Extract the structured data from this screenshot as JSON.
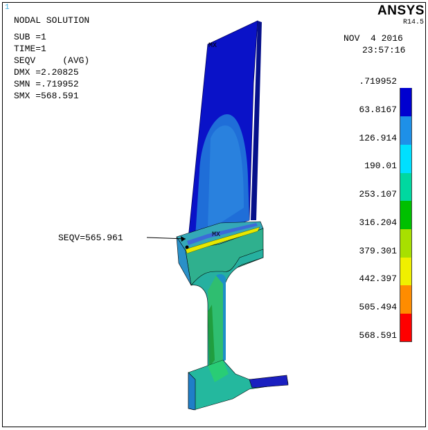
{
  "window_number": "1",
  "brand": "ANSYS",
  "version": "R14.5",
  "title": "NODAL SOLUTION",
  "info_lines": [
    "SUB =1",
    "TIME=1",
    "SEQV     (AVG)",
    "DMX =2.20825",
    "SMN =.719952",
    "SMX =568.591"
  ],
  "date": "NOV  4 2016",
  "time": "23:57:16",
  "probe_label": "SEQV=565.961",
  "max_markers": [
    "MX",
    "MX"
  ],
  "legend": {
    "values": [
      ".719952",
      "63.8167",
      "126.914",
      "190.01",
      "253.107",
      "316.204",
      "379.301",
      "442.397",
      "505.494",
      "568.591"
    ],
    "colors": [
      "#0000d0",
      "#1e90e8",
      "#00e0ff",
      "#00d8a0",
      "#00c000",
      "#a8e000",
      "#f0f000",
      "#ff8c00",
      "#ff0000"
    ]
  }
}
